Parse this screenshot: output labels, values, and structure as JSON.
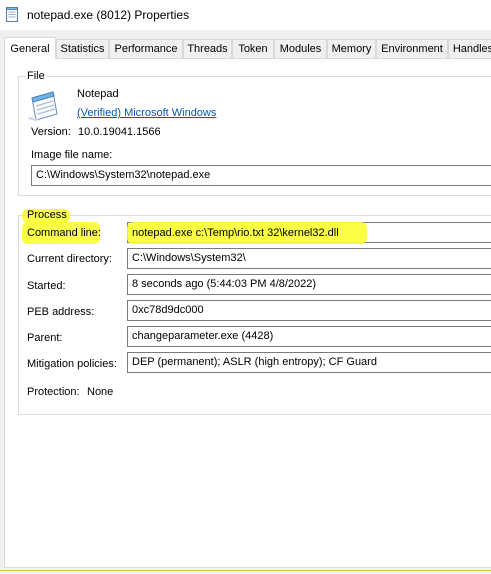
{
  "window": {
    "title": "notepad.exe (8012) Properties"
  },
  "tabs": [
    {
      "label": "General"
    },
    {
      "label": "Statistics"
    },
    {
      "label": "Performance"
    },
    {
      "label": "Threads"
    },
    {
      "label": "Token"
    },
    {
      "label": "Modules"
    },
    {
      "label": "Memory"
    },
    {
      "label": "Environment"
    },
    {
      "label": "Handles"
    }
  ],
  "file_group": {
    "label": "File",
    "app_name": "Notepad",
    "publisher": "(Verified) Microsoft Windows",
    "version_label": "Version:",
    "version_value": "10.0.19041.1566",
    "image_label": "Image file name:",
    "image_value": "C:\\Windows\\System32\\notepad.exe",
    "icon": "notepad-icon"
  },
  "process_group": {
    "label": "Process",
    "command_line_label": "Command line:",
    "command_line_value": "notepad.exe c:\\Temp\\rio.txt  32\\kernel32.dll",
    "current_dir_label": "Current directory:",
    "current_dir_value": "C:\\Windows\\System32\\",
    "started_label": "Started:",
    "started_value": "8 seconds ago (5:44:03 PM 4/8/2022)",
    "peb_label": "PEB address:",
    "peb_value": "0xc78d9dc000",
    "parent_label": "Parent:",
    "parent_value": "changeparameter.exe (4428)",
    "mitigation_label": "Mitigation policies:",
    "mitigation_value": "DEP (permanent); ASLR (high entropy); CF Guard",
    "protection_label": "Protection:",
    "protection_value": "None"
  },
  "colors": {
    "highlight": "#fbff2b",
    "link": "#0a55b6"
  }
}
